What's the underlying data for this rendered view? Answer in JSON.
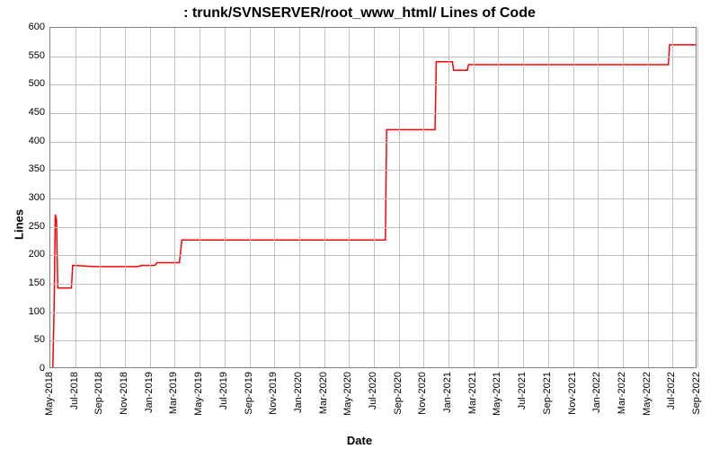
{
  "chart_data": {
    "type": "line",
    "title": ": trunk/SVNSERVER/root_www_html/ Lines of Code",
    "xlabel": "Date",
    "ylabel": "Lines",
    "ylim": [
      0,
      600
    ],
    "y_ticks": [
      0,
      50,
      100,
      150,
      200,
      250,
      300,
      350,
      400,
      450,
      500,
      550,
      600
    ],
    "x_tick_labels": [
      "May-2018",
      "Jul-2018",
      "Sep-2018",
      "Nov-2018",
      "Jan-2019",
      "Mar-2019",
      "May-2019",
      "Jul-2019",
      "Sep-2019",
      "Nov-2019",
      "Jan-2020",
      "Mar-2020",
      "May-2020",
      "Jul-2020",
      "Sep-2020",
      "Nov-2020",
      "Jan-2021",
      "Mar-2021",
      "May-2021",
      "Jul-2021",
      "Sep-2021",
      "Nov-2021",
      "Jan-2022",
      "Mar-2022",
      "May-2022",
      "Jul-2022",
      "Sep-2022"
    ],
    "x_domain_index": [
      0,
      26
    ],
    "line_color": "#ff0000",
    "series": [
      {
        "name": "Lines of Code",
        "points": [
          {
            "xi": 0.1,
            "y": 0
          },
          {
            "xi": 0.15,
            "y": 100
          },
          {
            "xi": 0.2,
            "y": 270
          },
          {
            "xi": 0.25,
            "y": 260
          },
          {
            "xi": 0.3,
            "y": 140
          },
          {
            "xi": 0.8,
            "y": 140
          },
          {
            "xi": 0.85,
            "y": 140
          },
          {
            "xi": 0.9,
            "y": 180
          },
          {
            "xi": 1.0,
            "y": 180
          },
          {
            "xi": 1.8,
            "y": 178
          },
          {
            "xi": 2.6,
            "y": 178
          },
          {
            "xi": 3.3,
            "y": 178
          },
          {
            "xi": 3.4,
            "y": 178
          },
          {
            "xi": 3.5,
            "y": 178
          },
          {
            "xi": 3.7,
            "y": 180
          },
          {
            "xi": 4.2,
            "y": 180
          },
          {
            "xi": 4.3,
            "y": 185
          },
          {
            "xi": 5.2,
            "y": 185
          },
          {
            "xi": 5.3,
            "y": 225
          },
          {
            "xi": 13.5,
            "y": 225
          },
          {
            "xi": 13.55,
            "y": 420
          },
          {
            "xi": 15.5,
            "y": 420
          },
          {
            "xi": 15.55,
            "y": 540
          },
          {
            "xi": 16.2,
            "y": 540
          },
          {
            "xi": 16.25,
            "y": 525
          },
          {
            "xi": 16.8,
            "y": 525
          },
          {
            "xi": 16.85,
            "y": 535
          },
          {
            "xi": 24.9,
            "y": 535
          },
          {
            "xi": 24.95,
            "y": 570
          },
          {
            "xi": 26.3,
            "y": 570
          }
        ]
      }
    ]
  }
}
